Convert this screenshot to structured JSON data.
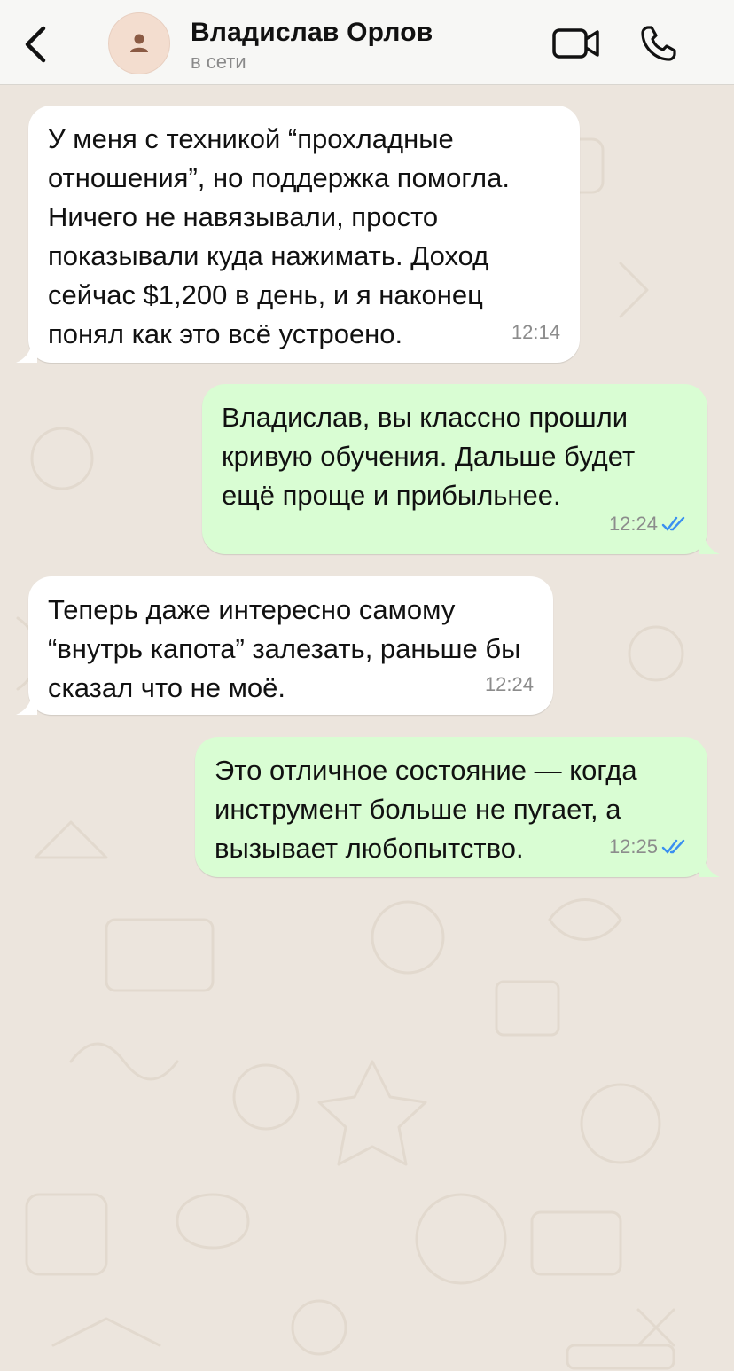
{
  "header": {
    "back_icon": "chevron-left-icon",
    "contact_name": "Владислав Орлов",
    "status": "в сети",
    "video_icon": "video-camera-icon",
    "call_icon": "phone-icon"
  },
  "colors": {
    "incoming_bubble": "#ffffff",
    "outgoing_bubble": "#d9fdd3",
    "chat_background": "#ece5dd",
    "read_ticks": "#3a8ff0"
  },
  "messages": [
    {
      "direction": "incoming",
      "text": "У меня с техникой “прохладные отношения”, но поддержка помогла. Ничего не навязывали, просто показывали куда нажимать. Доход сейчас $1,200 в день, и я наконец понял как это всё устроено.",
      "time": "12:14"
    },
    {
      "direction": "outgoing",
      "text": "Владислав, вы классно прошли кривую обучения. Дальше будет ещё проще и прибыльнее.",
      "time": "12:24",
      "status_icon": "double-check-read-icon"
    },
    {
      "direction": "incoming",
      "text": "Теперь даже интересно самому “внутрь капота” залезать, раньше бы сказал что не моё.",
      "time": "12:24"
    },
    {
      "direction": "outgoing",
      "text": "Это отличное состояние — когда инструмент больше не пугает, а вызывает любопытство.",
      "time": "12:25",
      "status_icon": "double-check-read-icon"
    }
  ]
}
